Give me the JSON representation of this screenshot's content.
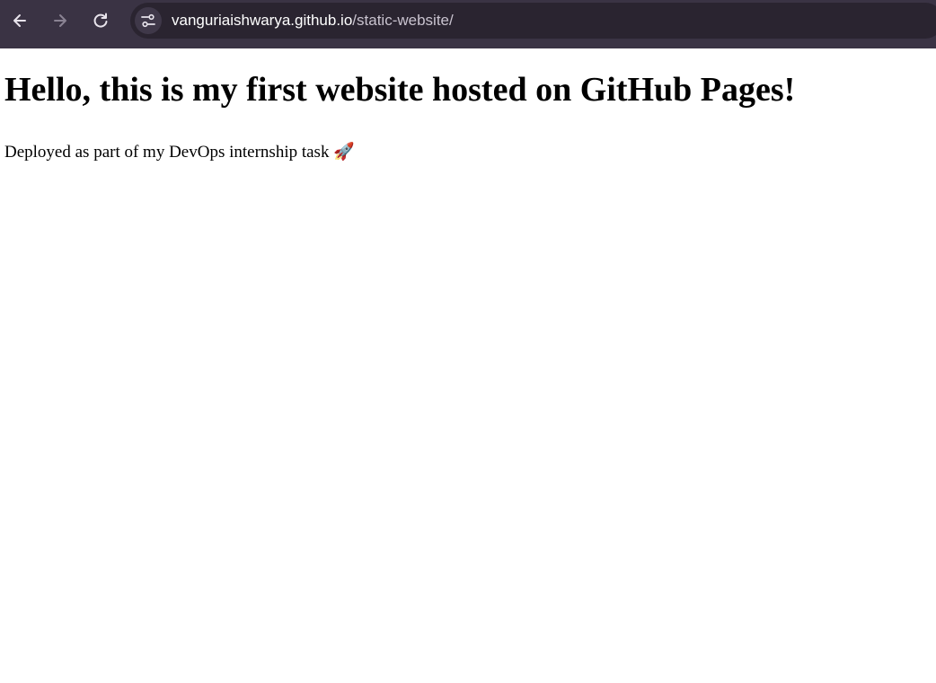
{
  "browser": {
    "url_host": "vanguriaishwarya.github.io",
    "url_path": "/static-website/",
    "icons": {
      "back": "back-arrow-icon",
      "forward": "forward-arrow-icon",
      "reload": "reload-icon",
      "site_info": "site-settings-icon"
    },
    "colors": {
      "toolbar": "#3a3344",
      "omnibox": "#2a2430"
    }
  },
  "page": {
    "heading": "Hello, this is my first website hosted on GitHub Pages!",
    "paragraph": "Deployed as part of my DevOps internship task 🚀"
  }
}
